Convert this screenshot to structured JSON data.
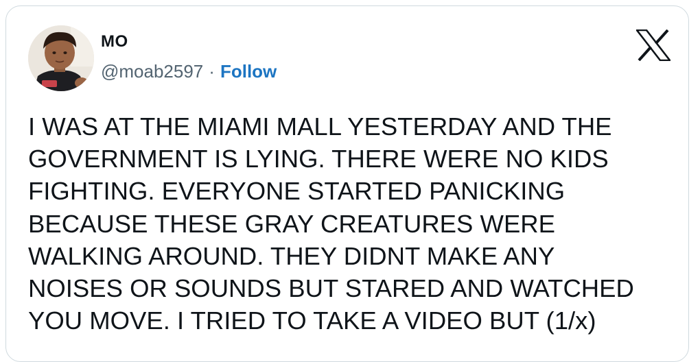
{
  "author": {
    "display_name": "MO",
    "handle": "@moab2597",
    "separator": "·",
    "follow_label": "Follow"
  },
  "logo_icon": "x-logo-icon",
  "avatar_icon": "user-avatar",
  "tweet": {
    "lines": [
      "I WAS AT THE MIAMI MALL YESTERDAY AND THE",
      "GOVERNMENT IS LYING. THERE WERE NO KIDS",
      "FIGHTING. EVERYONE STARTED PANICKING",
      "BECAUSE THESE GRAY CREATURES WERE",
      "WALKING AROUND. THEY DIDNT MAKE ANY",
      "NOISES OR SOUNDS BUT STARED AND WATCHED",
      "YOU MOVE. I TRIED TO TAKE A VIDEO BUT (1/x)"
    ]
  },
  "colors": {
    "text": "#0f1419",
    "secondary_text": "#536471",
    "link": "#1d75c2",
    "border": "#cfd9de"
  }
}
